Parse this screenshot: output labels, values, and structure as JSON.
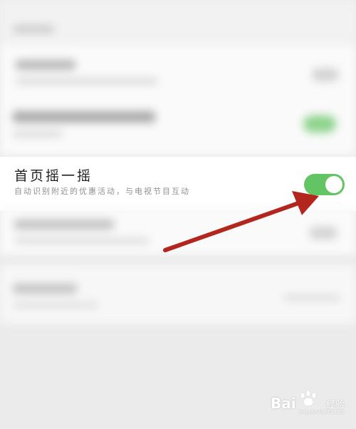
{
  "setting": {
    "title": "首页摇一摇",
    "description": "自动识别附近的优惠活动，与电视节目互动",
    "toggle_state": "on"
  },
  "colors": {
    "toggle_on": "#62c462",
    "arrow": "#b3261e"
  },
  "watermark": {
    "brand": "Bai",
    "brand_suffix": "经验",
    "url": "jingyan.baidu.com"
  }
}
